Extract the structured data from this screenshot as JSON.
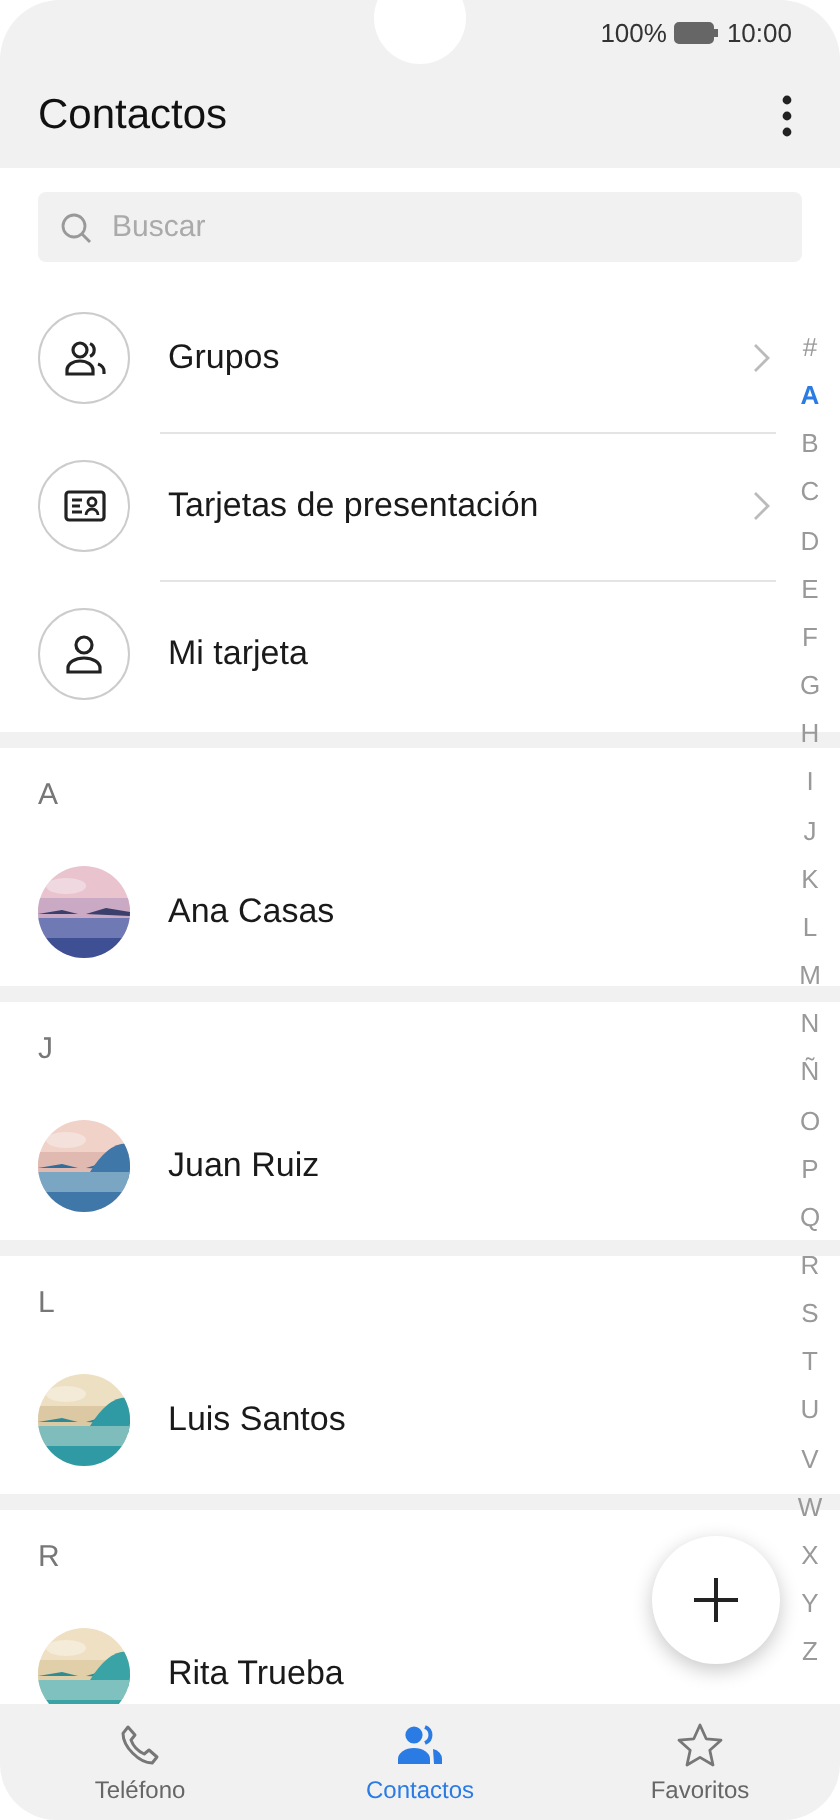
{
  "status_bar": {
    "battery": "100%",
    "time": "10:00"
  },
  "header": {
    "title": "Contactos"
  },
  "search": {
    "placeholder": "Buscar"
  },
  "menu_items": [
    {
      "label": "Grupos",
      "kind": "group",
      "chevron": true
    },
    {
      "label": "Tarjetas de presentación",
      "kind": "card",
      "chevron": true
    },
    {
      "label": "Mi tarjeta",
      "kind": "person",
      "chevron": false
    }
  ],
  "sections": [
    {
      "letter": "A",
      "contacts": [
        {
          "name": "Ana Casas"
        }
      ]
    },
    {
      "letter": "J",
      "contacts": [
        {
          "name": "Juan Ruiz"
        }
      ]
    },
    {
      "letter": "L",
      "contacts": [
        {
          "name": "Luis Santos"
        }
      ]
    },
    {
      "letter": "R",
      "contacts": [
        {
          "name": "Rita Trueba"
        }
      ]
    }
  ],
  "index": [
    {
      "letter": "#",
      "selected": false
    },
    {
      "letter": "A",
      "selected": true
    },
    {
      "letter": "B",
      "selected": false
    },
    {
      "letter": "C",
      "selected": false
    },
    {
      "letter": "D",
      "selected": false
    },
    {
      "letter": "E",
      "selected": false
    },
    {
      "letter": "F",
      "selected": false
    },
    {
      "letter": "G",
      "selected": false
    },
    {
      "letter": "H",
      "selected": false
    },
    {
      "letter": "I",
      "selected": false
    },
    {
      "letter": "J",
      "selected": false
    },
    {
      "letter": "K",
      "selected": false
    },
    {
      "letter": "L",
      "selected": false
    },
    {
      "letter": "M",
      "selected": false
    },
    {
      "letter": "N",
      "selected": false
    },
    {
      "letter": "Ñ",
      "selected": false
    },
    {
      "letter": "O",
      "selected": false
    },
    {
      "letter": "P",
      "selected": false
    },
    {
      "letter": "Q",
      "selected": false
    },
    {
      "letter": "R",
      "selected": false
    },
    {
      "letter": "S",
      "selected": false
    },
    {
      "letter": "T",
      "selected": false
    },
    {
      "letter": "U",
      "selected": false
    },
    {
      "letter": "V",
      "selected": false
    },
    {
      "letter": "W",
      "selected": false
    },
    {
      "letter": "X",
      "selected": false
    },
    {
      "letter": "Y",
      "selected": false
    },
    {
      "letter": "Z",
      "selected": false
    }
  ],
  "nav_tabs": [
    {
      "label": "Teléfono",
      "kind": "phone",
      "selected": false
    },
    {
      "label": "Contactos",
      "kind": "people",
      "selected": true
    },
    {
      "label": "Favoritos",
      "kind": "star",
      "selected": false
    }
  ]
}
